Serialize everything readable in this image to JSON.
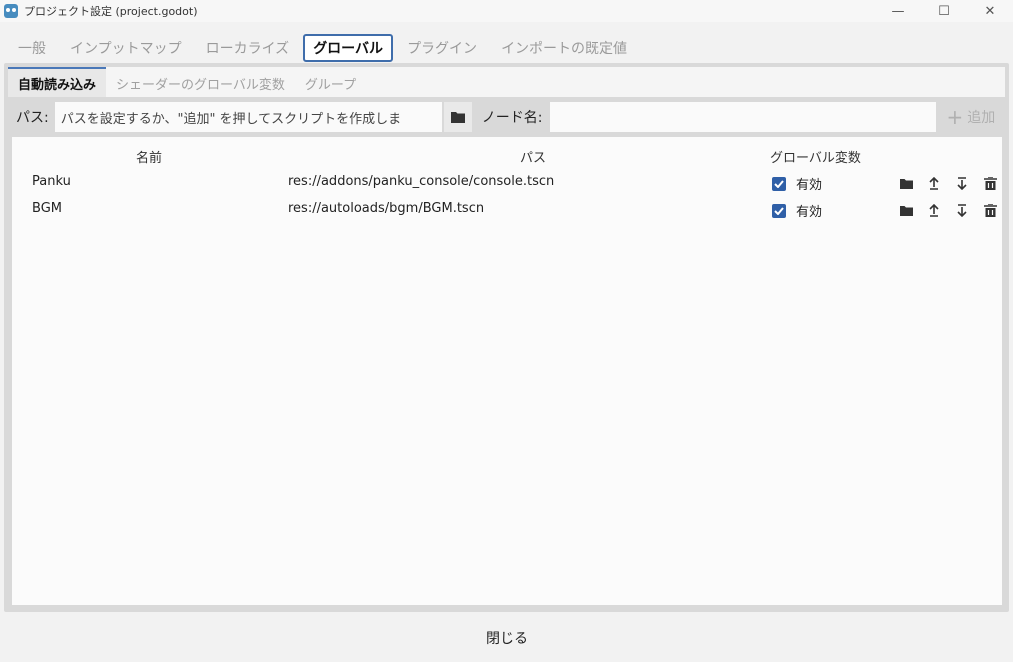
{
  "window": {
    "title": "プロジェクト設定 (project.godot)",
    "minimize": "—",
    "maximize": "☐",
    "close": "✕"
  },
  "main_tabs": [
    {
      "label": "一般",
      "active": false
    },
    {
      "label": "インプットマップ",
      "active": false
    },
    {
      "label": "ローカライズ",
      "active": false
    },
    {
      "label": "グローバル",
      "active": true
    },
    {
      "label": "プラグイン",
      "active": false
    },
    {
      "label": "インポートの既定値",
      "active": false
    }
  ],
  "sub_tabs": [
    {
      "label": "自動読み込み",
      "active": true
    },
    {
      "label": "シェーダーのグローバル変数",
      "active": false
    },
    {
      "label": "グループ",
      "active": false
    }
  ],
  "path_row": {
    "path_label": "パス:",
    "path_placeholder": "パスを設定するか、\"追加\" を押してスクリプトを作成しま",
    "node_label": "ノード名:",
    "node_value": "",
    "add_label": "追加"
  },
  "columns": {
    "name": "名前",
    "path": "パス",
    "global": "グローバル変数"
  },
  "rows": [
    {
      "name": "Panku",
      "path": "res://addons/panku_console/console.tscn",
      "enabled": true,
      "enabled_label": "有効"
    },
    {
      "name": "BGM",
      "path": "res://autoloads/bgm/BGM.tscn",
      "enabled": true,
      "enabled_label": "有効"
    }
  ],
  "footer": {
    "close_label": "閉じる"
  },
  "colors": {
    "accent": "#3f6dab",
    "checkbox": "#2f5fa7"
  }
}
